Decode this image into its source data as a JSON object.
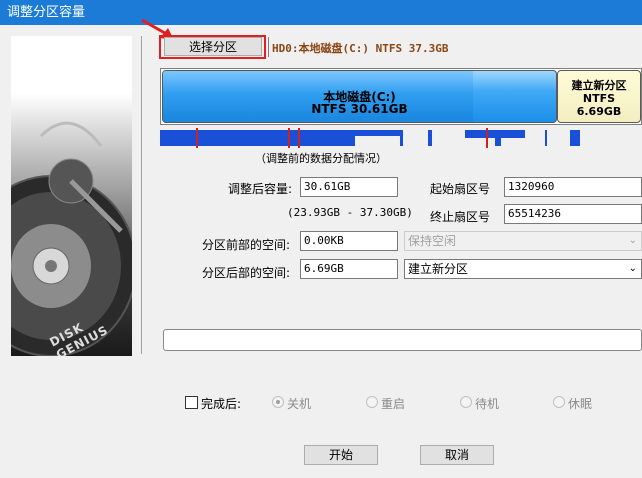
{
  "window": {
    "title": "调整分区容量"
  },
  "side_image": {
    "brand": "DISK GENIUS"
  },
  "toolbar": {
    "select_partition": "选择分区"
  },
  "disk_info": "HD0:本地磁盘(C:) NTFS 37.3GB",
  "disk_bar": {
    "partition1": {
      "name": "本地磁盘(C:)",
      "fs_size": "NTFS 30.61GB"
    },
    "partition2": {
      "name": "建立新分区",
      "fs": "NTFS",
      "size": "6.69GB"
    }
  },
  "distribution_caption": "（调整前的数据分配情况）",
  "form": {
    "size_after_label": "调整后容量:",
    "size_after_value": "30.61GB",
    "size_range": "(23.93GB - 37.30GB)",
    "start_sector_label": "起始扇区号",
    "start_sector_value": "1320960",
    "end_sector_label": "终止扇区号",
    "end_sector_value": "65514236",
    "before_space_label": "分区前部的空间:",
    "before_space_value": "0.00KB",
    "before_action": "保持空闲",
    "after_space_label": "分区后部的空间:",
    "after_space_value": "6.69GB",
    "after_action": "建立新分区"
  },
  "after_complete": {
    "label": "完成后:",
    "options": [
      "关机",
      "重启",
      "待机",
      "休眠"
    ]
  },
  "buttons": {
    "start": "开始",
    "cancel": "取消"
  },
  "colors": {
    "titlebar": "#1b7bd6",
    "partition1": "#3fa9f5",
    "partition2": "#f3eec0",
    "highlight": "#e02020"
  }
}
